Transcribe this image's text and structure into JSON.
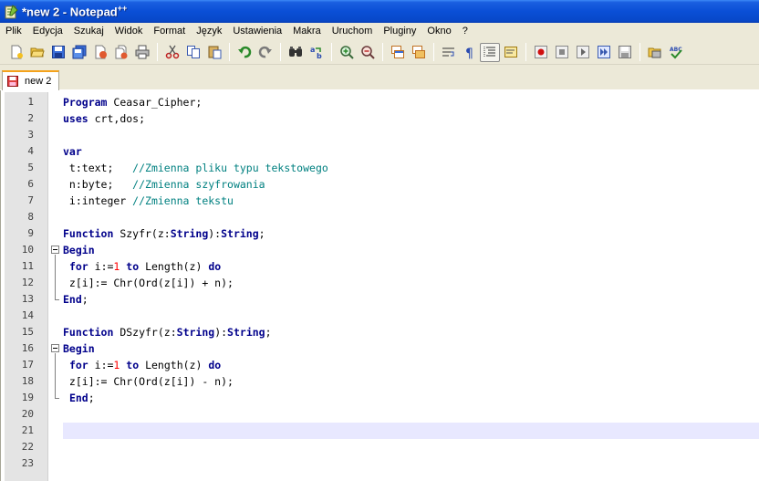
{
  "window": {
    "title": "*new  2 - Notepad",
    "title_suffix": "++"
  },
  "menu": [
    "Plik",
    "Edycja",
    "Szukaj",
    "Widok",
    "Format",
    "Język",
    "Ustawienia",
    "Makra",
    "Uruchom",
    "Pluginy",
    "Okno",
    "?"
  ],
  "toolbar": {
    "icons": [
      "new-file-icon",
      "open-folder-icon",
      "save-icon",
      "save-all-icon",
      "close-icon",
      "close-all-icon",
      "print-icon",
      "cut-icon",
      "copy-icon",
      "paste-icon",
      "undo-icon",
      "redo-icon",
      "find-icon",
      "replace-icon",
      "zoom-in-icon",
      "zoom-out-icon",
      "sync-vertical-icon",
      "sync-horizontal-icon",
      "word-wrap-icon",
      "show-all-chars-icon",
      "indent-guide-icon",
      "user-lang-icon",
      "record-macro-icon",
      "stop-record-icon",
      "play-macro-icon",
      "run-macro-multiple-icon",
      "save-macro-icon",
      "launch-browser-icon",
      "spell-check-icon"
    ]
  },
  "tab": {
    "label": "new 2"
  },
  "editor": {
    "current_line": 21,
    "lines": [
      {
        "n": "1",
        "html": "<span class='kw'>Program</span> Ceasar_Cipher;"
      },
      {
        "n": "2",
        "html": "<span class='kw'>uses</span> crt,dos;"
      },
      {
        "n": "3",
        "html": ""
      },
      {
        "n": "4",
        "html": "<span class='kw'>var</span>"
      },
      {
        "n": "5",
        "html": " t:text;   <span class='cmt'>//Zmienna pliku typu tekstowego</span>"
      },
      {
        "n": "6",
        "html": " n:byte;   <span class='cmt'>//Zmienna szyfrowania</span>"
      },
      {
        "n": "7",
        "html": " i:integer <span class='cmt'>//Zmienna tekstu</span>"
      },
      {
        "n": "8",
        "html": ""
      },
      {
        "n": "9",
        "html": "<span class='kw'>Function</span> Szyfr(z:<span class='kw'>String</span>):<span class='kw'>String</span>;"
      },
      {
        "n": "10",
        "html": "<span class='kw'>Begin</span>"
      },
      {
        "n": "11",
        "html": " <span class='kw'>for</span> i:=<span class='num'>1</span> <span class='kw'>to</span> Length(z) <span class='kw'>do</span>"
      },
      {
        "n": "12",
        "html": " z[i]:= Chr(Ord(z[i]) + n);"
      },
      {
        "n": "13",
        "html": "<span class='kw'>End</span>;"
      },
      {
        "n": "14",
        "html": ""
      },
      {
        "n": "15",
        "html": "<span class='kw'>Function</span> DSzyfr(z:<span class='kw'>String</span>):<span class='kw'>String</span>;"
      },
      {
        "n": "16",
        "html": "<span class='kw'>Begin</span>"
      },
      {
        "n": "17",
        "html": " <span class='kw'>for</span> i:=<span class='num'>1</span> <span class='kw'>to</span> Length(z) <span class='kw'>do</span>"
      },
      {
        "n": "18",
        "html": " z[i]:= Chr(Ord(z[i]) - n);"
      },
      {
        "n": "19",
        "html": " <span class='kw'>End</span>;"
      },
      {
        "n": "20",
        "html": ""
      },
      {
        "n": "21",
        "html": ""
      },
      {
        "n": "22",
        "html": ""
      },
      {
        "n": "23",
        "html": ""
      }
    ]
  }
}
